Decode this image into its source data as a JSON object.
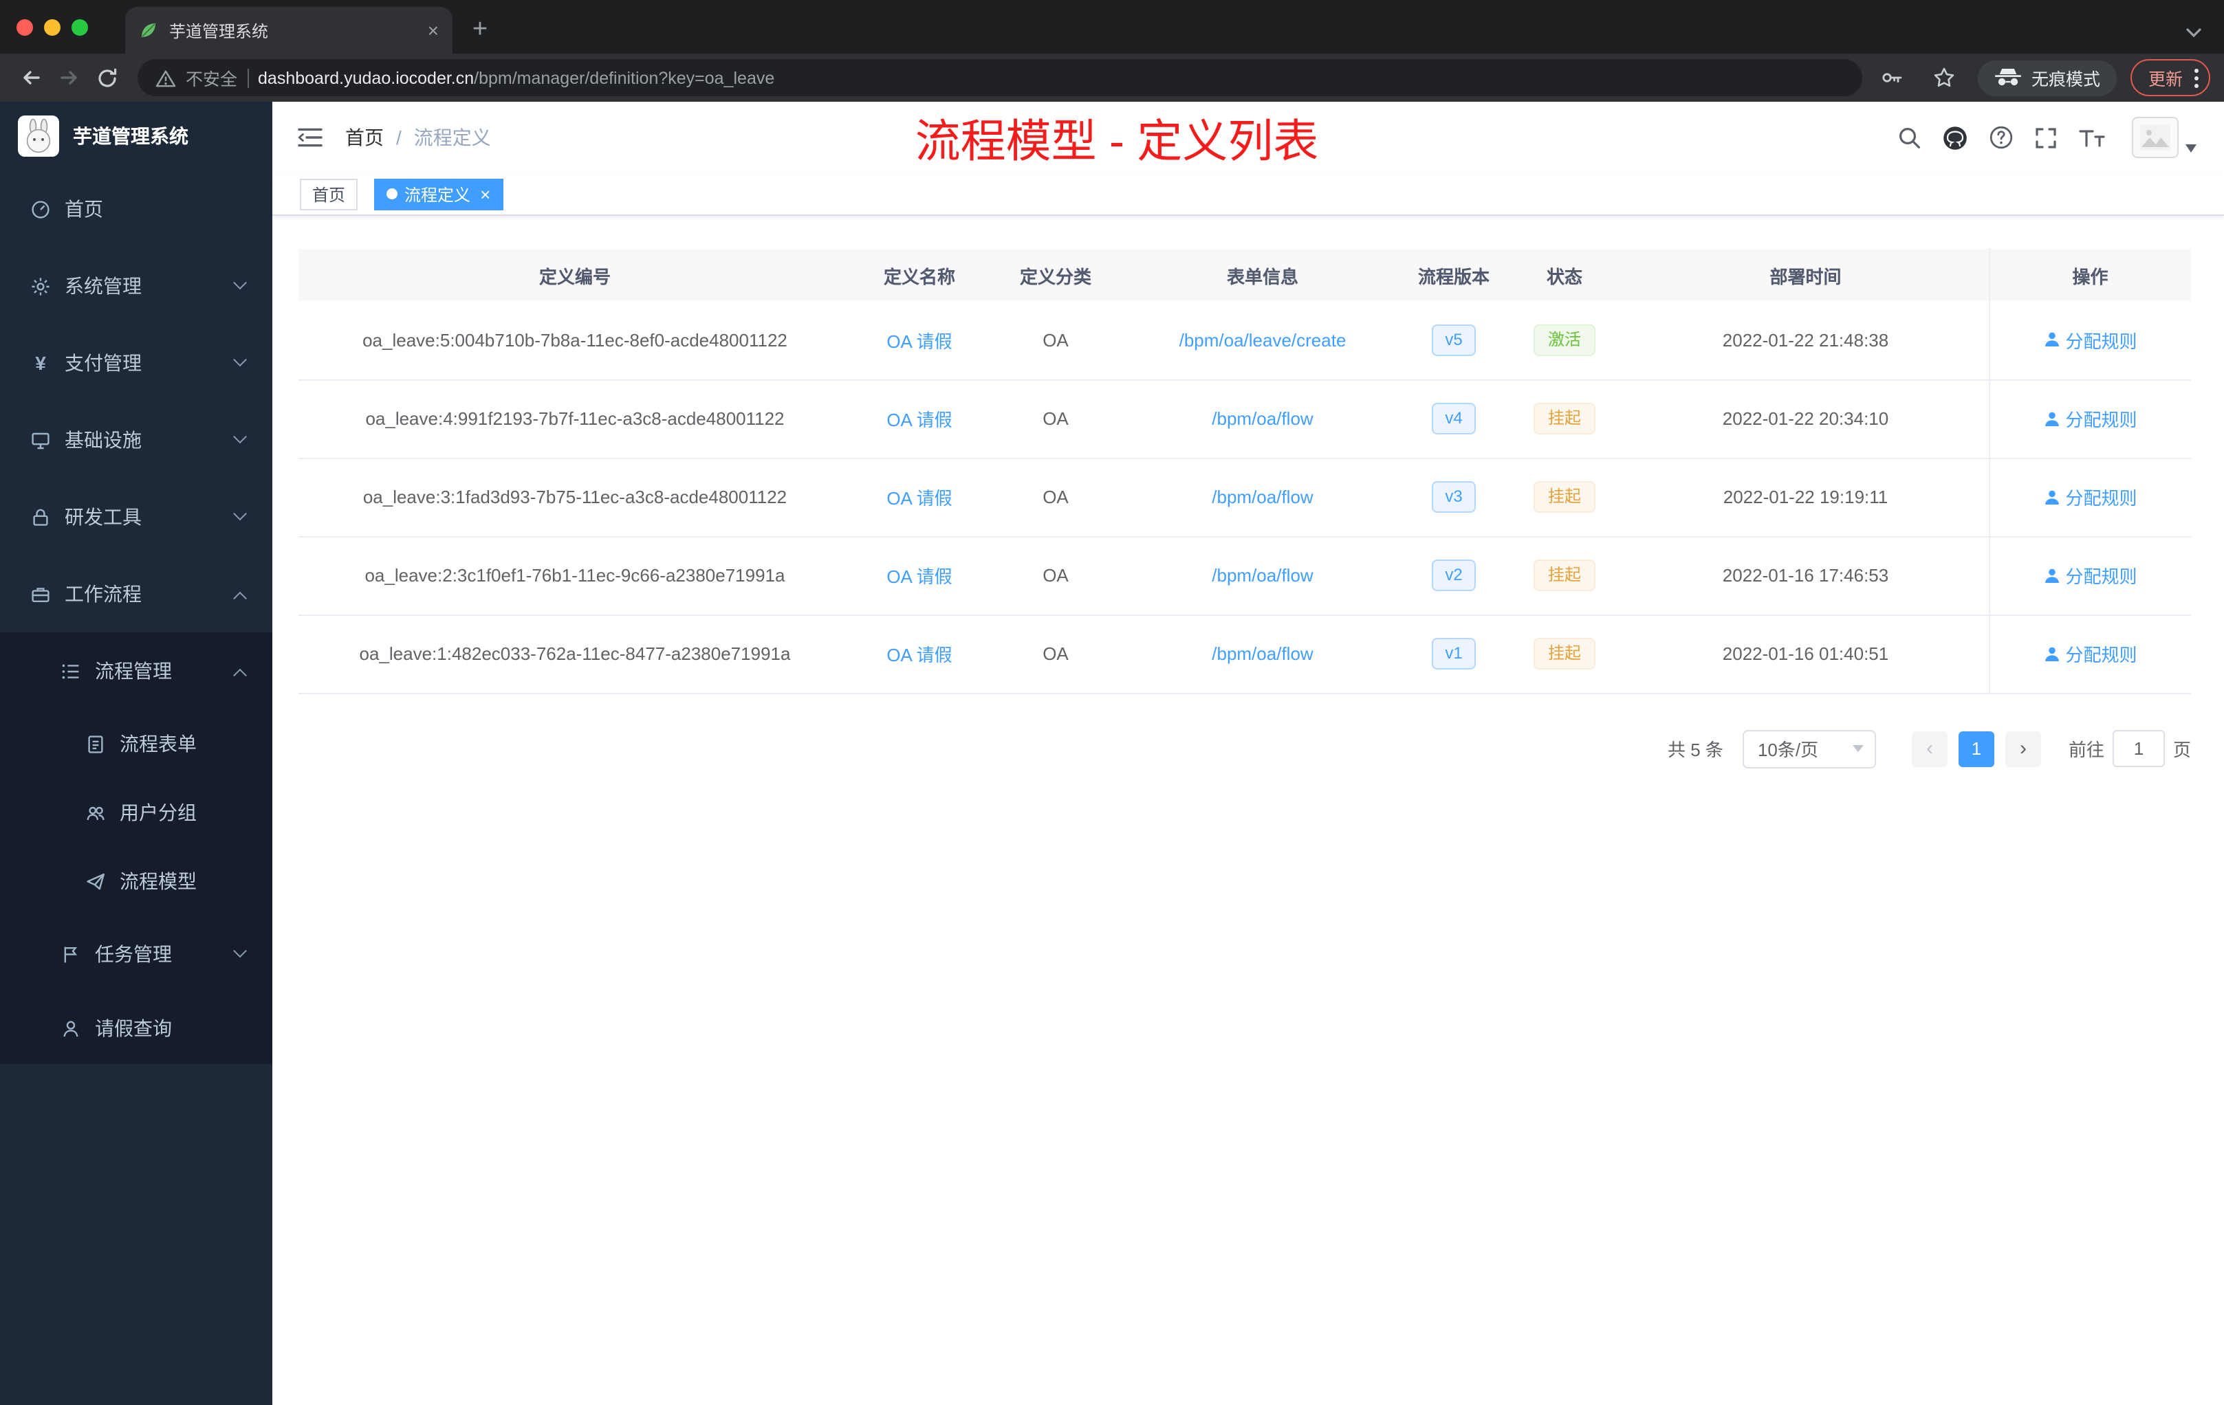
{
  "colors": {
    "primary": "#409eff",
    "annotation_red": "#f51c1c",
    "success": "#67c23a",
    "warning": "#e6a23c",
    "sidebar_bg": "#1d2939",
    "sidebar_submenu_bg": "#141d29"
  },
  "glyphs": {
    "close": "×",
    "plus": "+",
    "yen": "¥",
    "prev": "‹",
    "next": "›",
    "slash": "/"
  },
  "browser": {
    "tab_title": "芋道管理系统",
    "security_label": "不安全",
    "url_host": "dashboard.yudao.iocoder.cn",
    "url_path": "/bpm/manager/definition?key=oa_leave",
    "incognito_label": "无痕模式",
    "update_label": "更新",
    "icons": [
      "back",
      "forward",
      "reload",
      "warning-triangle",
      "key",
      "star",
      "incognito",
      "kebab-menu",
      "tab-search-caret",
      "leaf-favicon"
    ]
  },
  "sidebar": {
    "logo_title": "芋道管理系统",
    "items": [
      {
        "label": "首页",
        "icon": "dashboard-icon"
      },
      {
        "label": "系统管理",
        "icon": "gear-icon",
        "expandable": true
      },
      {
        "label": "支付管理",
        "icon": "yen-icon",
        "expandable": true
      },
      {
        "label": "基础设施",
        "icon": "infrastructure-icon",
        "expandable": true
      },
      {
        "label": "研发工具",
        "icon": "devtools-lock-icon",
        "expandable": true
      },
      {
        "label": "工作流程",
        "icon": "workflow-briefcase-icon",
        "expandable": true,
        "expanded": true
      },
      {
        "label": "流程管理",
        "icon": "process-list-icon",
        "expandable": true,
        "expanded": true
      },
      {
        "label": "流程表单",
        "icon": "form-document-icon"
      },
      {
        "label": "用户分组",
        "icon": "user-group-icon"
      },
      {
        "label": "流程模型",
        "icon": "paper-plane-icon"
      },
      {
        "label": "任务管理",
        "icon": "task-flag-icon",
        "expandable": true
      },
      {
        "label": "请假查询",
        "icon": "person-icon"
      }
    ]
  },
  "header": {
    "breadcrumb": {
      "home": "首页",
      "current": "流程定义"
    },
    "annotation": "流程模型 - 定义列表",
    "icons": [
      "search",
      "github",
      "question",
      "fullscreen",
      "font-size",
      "avatar",
      "caret-down"
    ]
  },
  "tags": {
    "home": "首页",
    "active": "流程定义"
  },
  "table": {
    "columns": [
      "定义编号",
      "定义名称",
      "定义分类",
      "表单信息",
      "流程版本",
      "状态",
      "部署时间",
      "操作"
    ],
    "rows": [
      {
        "id": "oa_leave:5:004b710b-7b8a-11ec-8ef0-acde48001122",
        "name": "OA 请假",
        "category": "OA",
        "form": "/bpm/oa/leave/create",
        "version": "v5",
        "status": "激活",
        "status_type": "success",
        "time": "2022-01-22 21:48:38",
        "action": "分配规则"
      },
      {
        "id": "oa_leave:4:991f2193-7b7f-11ec-a3c8-acde48001122",
        "name": "OA 请假",
        "category": "OA",
        "form": "/bpm/oa/flow",
        "version": "v4",
        "status": "挂起",
        "status_type": "warning",
        "time": "2022-01-22 20:34:10",
        "action": "分配规则"
      },
      {
        "id": "oa_leave:3:1fad3d93-7b75-11ec-a3c8-acde48001122",
        "name": "OA 请假",
        "category": "OA",
        "form": "/bpm/oa/flow",
        "version": "v3",
        "status": "挂起",
        "status_type": "warning",
        "time": "2022-01-22 19:19:11",
        "action": "分配规则"
      },
      {
        "id": "oa_leave:2:3c1f0ef1-76b1-11ec-9c66-a2380e71991a",
        "name": "OA 请假",
        "category": "OA",
        "form": "/bpm/oa/flow",
        "version": "v2",
        "status": "挂起",
        "status_type": "warning",
        "time": "2022-01-16 17:46:53",
        "action": "分配规则"
      },
      {
        "id": "oa_leave:1:482ec033-762a-11ec-8477-a2380e71991a",
        "name": "OA 请假",
        "category": "OA",
        "form": "/bpm/oa/flow",
        "version": "v1",
        "status": "挂起",
        "status_type": "warning",
        "time": "2022-01-16 01:40:51",
        "action": "分配规则"
      }
    ]
  },
  "pagination": {
    "total": "共 5 条",
    "page_size": "10条/页",
    "current_page": "1",
    "goto_label": "前往",
    "goto_value": "1",
    "page_unit": "页"
  }
}
